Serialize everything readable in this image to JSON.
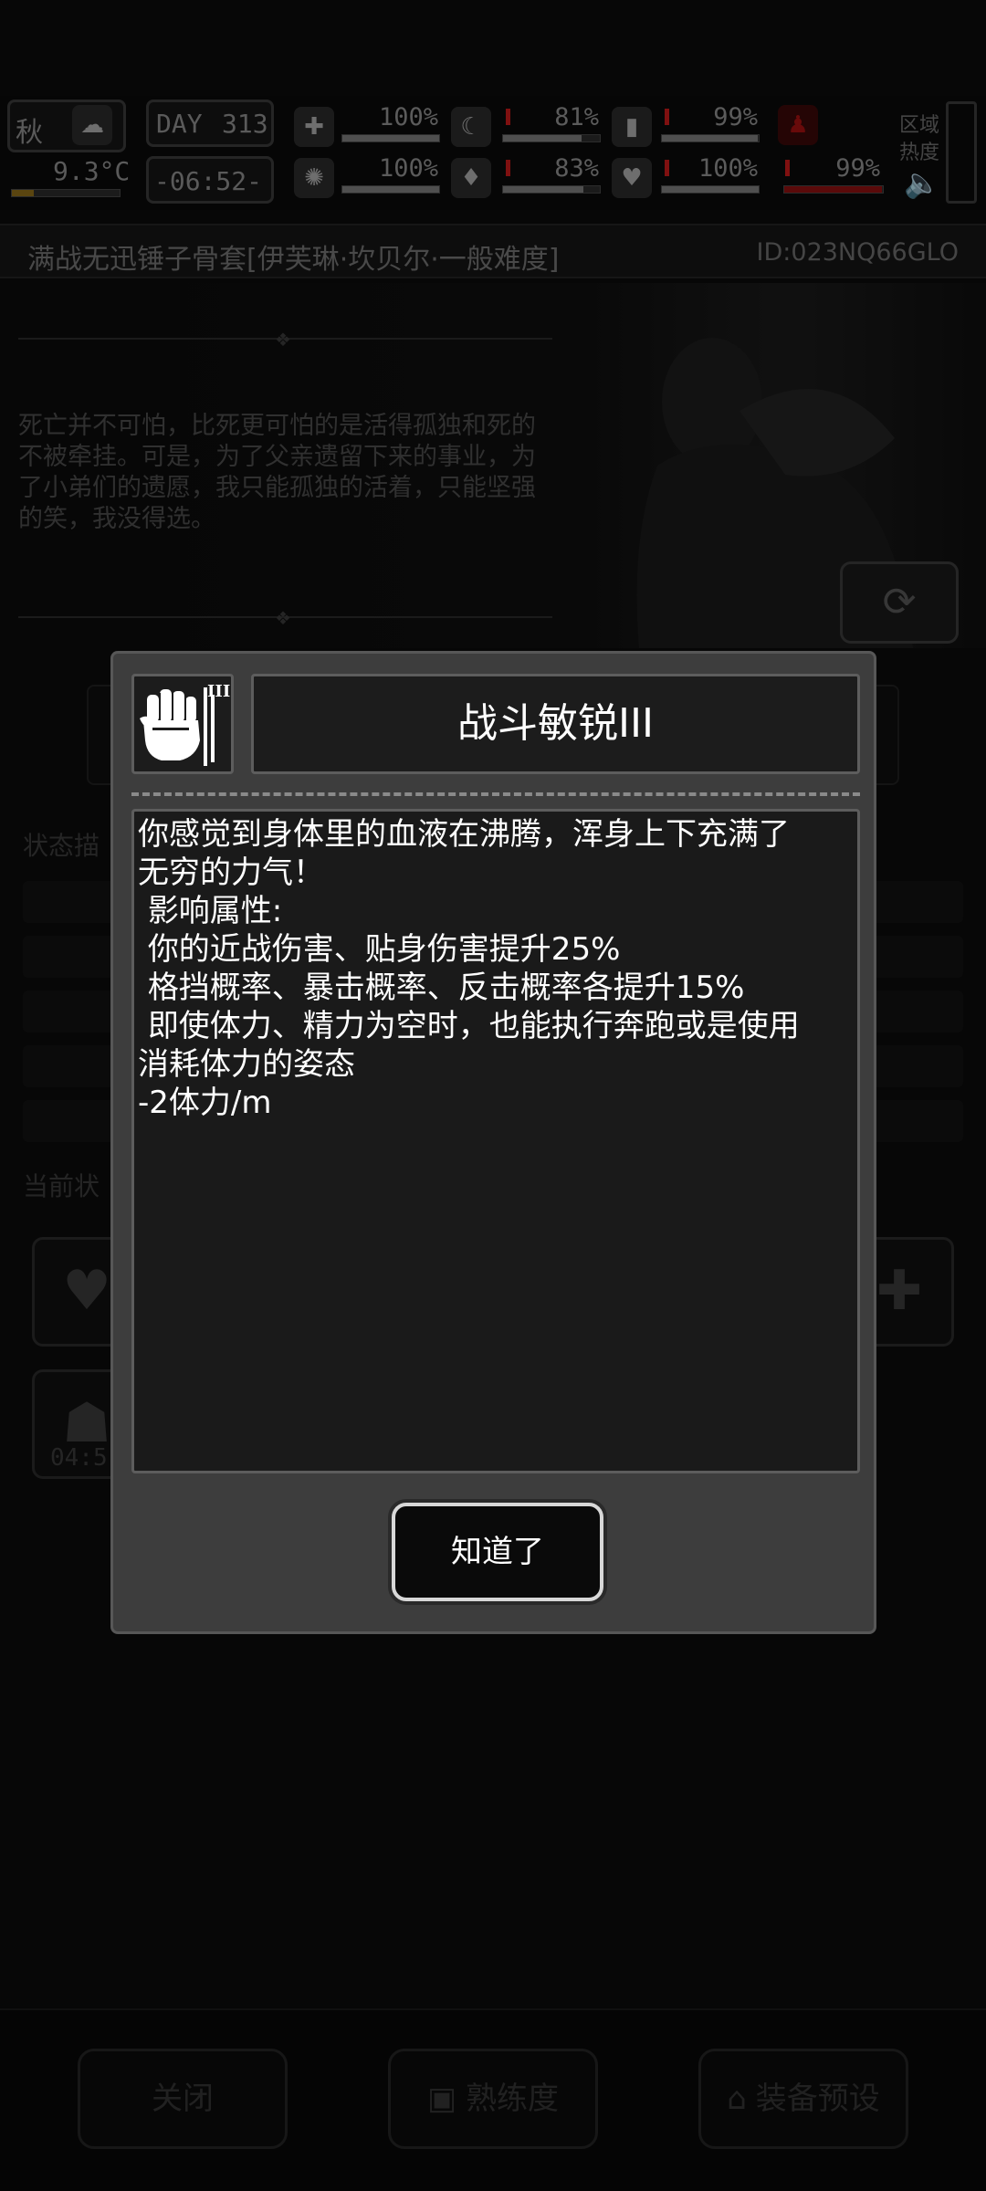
{
  "status": {
    "season": "秋",
    "temperature": "9.3°C",
    "day_label": "DAY",
    "day": "313",
    "time": "-06:52-",
    "stats": [
      {
        "icon": "medkit-icon",
        "value": "100%",
        "level": 1.0,
        "critical": false
      },
      {
        "icon": "stomach-icon",
        "value": "81%",
        "level": 0.81,
        "critical": false
      },
      {
        "icon": "battery-icon",
        "value": "99%",
        "level": 0.99,
        "critical": false
      },
      {
        "icon": "brain-icon",
        "value": "100%",
        "level": 1.0,
        "critical": false
      },
      {
        "icon": "water-drop-icon",
        "value": "83%",
        "level": 0.83,
        "critical": false
      },
      {
        "icon": "heart-icon",
        "value": "100%",
        "level": 1.0,
        "critical": false
      },
      {
        "icon": "stamina-figure-icon",
        "value": "99%",
        "level": 0.99,
        "critical": true
      }
    ],
    "zone_label_1": "区域",
    "zone_label_2": "热度"
  },
  "header": {
    "title": "满战无迅锤子骨套[伊芙琳·坎贝尔·一般难度]",
    "id": "ID:023NQ66GLO"
  },
  "hero": {
    "quote": "死亡并不可怕，比死更可怕的是活得孤独和死的不被牵挂。可是，为了父亲遗留下来的事业，为了小弟们的遗愿，我只能孤独的活着，只能坚强的笑，我没得选。"
  },
  "background_panels": {
    "status_desc_label": "状态描",
    "current_status_label": "当前状",
    "timer": "04:5"
  },
  "bottom_bar": {
    "close": "关闭",
    "proficiency": "熟练度",
    "equipment_preset": "装备预设"
  },
  "modal": {
    "skill_level_mark": "III",
    "title": "战斗敏锐III",
    "description_lines": [
      "你感觉到身体里的血液在沸腾，浑身上下充满了",
      "无穷的力气！",
      " 影响属性:",
      " 你的近战伤害、贴身伤害提升25%",
      " 格挡概率、暴击概率、反击概率各提升15%",
      " 即使体力、精力为空时，也能执行奔跑或是使用",
      "消耗体力的姿态",
      "-2体力/m"
    ],
    "ok_label": "知道了"
  },
  "colors": {
    "modal_bg": "#3d3d3d",
    "panel_bg": "#1a1a1a",
    "critical_red": "#c41a1a"
  }
}
